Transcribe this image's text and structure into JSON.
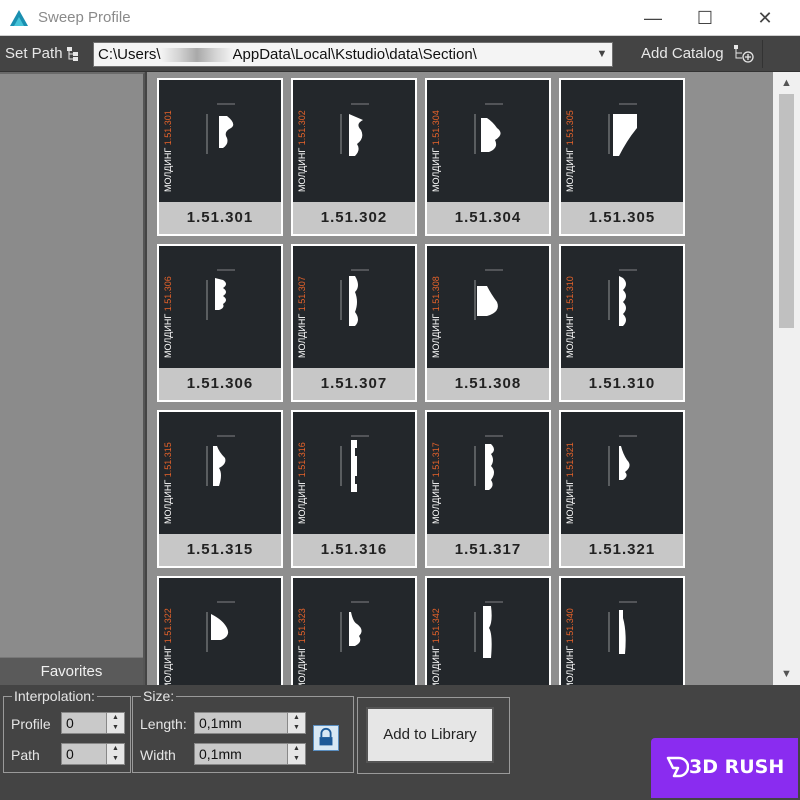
{
  "window": {
    "title": "Sweep Profile",
    "minimize": "—",
    "maximize": "☐",
    "close": "✕"
  },
  "toolbar": {
    "set_path_label": "Set Path",
    "path_value": "C:\\Users\\",
    "path_value_rest": "AppData\\Local\\Kstudio\\data\\Section\\",
    "add_catalog_label": "Add Catalog"
  },
  "sidebar": {
    "favorites_label": "Favorites"
  },
  "grid": {
    "tiles": [
      {
        "label": "1.51.301"
      },
      {
        "label": "1.51.302"
      },
      {
        "label": "1.51.304"
      },
      {
        "label": "1.51.305"
      },
      {
        "label": "1.51.306"
      },
      {
        "label": "1.51.307"
      },
      {
        "label": "1.51.308"
      },
      {
        "label": "1.51.310"
      },
      {
        "label": "1.51.315"
      },
      {
        "label": "1.51.316"
      },
      {
        "label": "1.51.317"
      },
      {
        "label": "1.51.321"
      },
      {
        "label": ""
      },
      {
        "label": ""
      },
      {
        "label": ""
      },
      {
        "label": ""
      }
    ],
    "side_label": "МОЛДИНГ",
    "side_codes": [
      "1.51.301",
      "1.51.302",
      "1.51.304",
      "1.51.305",
      "1.51.306",
      "1.51.307",
      "1.51.308",
      "1.51.310",
      "1.51.315",
      "1.51.316",
      "1.51.317",
      "1.51.321",
      "1.51.322",
      "1.51.323",
      "1.51.342",
      "1.51.340"
    ]
  },
  "interpolation": {
    "title": "Interpolation:",
    "profile_label": "Profile",
    "profile_value": "0",
    "path_label": "Path",
    "path_value": "0"
  },
  "size": {
    "title": "Size:",
    "length_label": "Length:",
    "length_value": "0,1mm",
    "width_label": "Width",
    "width_value": "0,1mm"
  },
  "actions": {
    "add_to_library": "Add to Library"
  },
  "brand": {
    "text": "3D RUSH"
  },
  "colors": {
    "accent_orange": "#e8632a",
    "brand_purple": "#8a2cf0",
    "tile_bg": "#23272b"
  }
}
